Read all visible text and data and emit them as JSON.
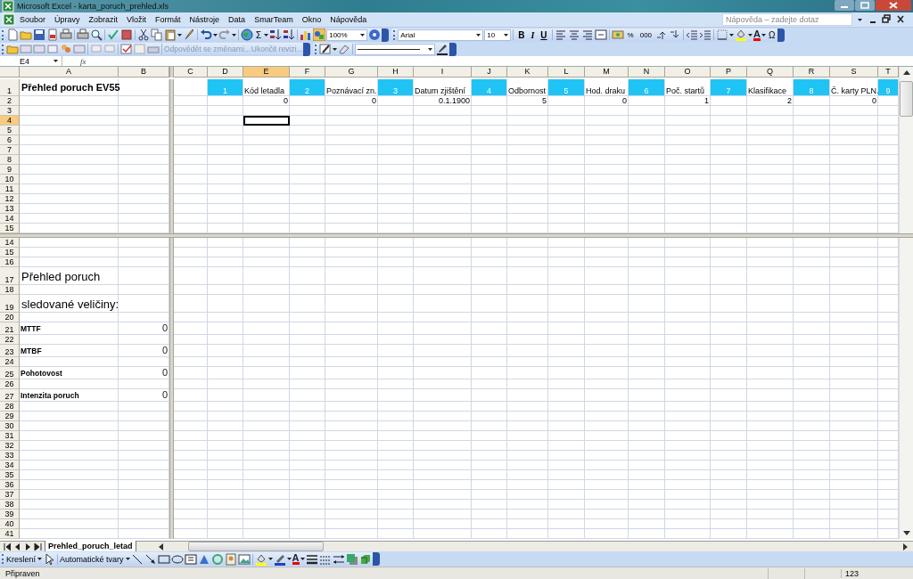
{
  "window": {
    "title": "Microsoft Excel - karta_poruch_prehled.xls"
  },
  "menu": [
    "Soubor",
    "Úpravy",
    "Zobrazit",
    "Vložit",
    "Formát",
    "Nástroje",
    "Data",
    "SmarTeam",
    "Okno",
    "Nápověda"
  ],
  "help_search": {
    "placeholder": "Nápověda – zadejte dotaz"
  },
  "standard_toolbar": {
    "sum": "Σ",
    "zoom": "100%"
  },
  "formatting_toolbar": {
    "font": "Arial",
    "size": "10",
    "style_buttons": [
      "B",
      "I",
      "U"
    ],
    "number_buttons": [
      "%",
      "000"
    ],
    "font_color": "A",
    "symbol": "Ω"
  },
  "review_toolbar": {
    "buttons": [
      {
        "label": "Odpovědět se změnami...",
        "disabled": true
      },
      {
        "label": "Ukončit revizi...",
        "disabled": true
      }
    ]
  },
  "formula_bar": {
    "name_box": "E4",
    "fx": "fx"
  },
  "columns_left": [
    {
      "label": "A",
      "selected": false
    },
    {
      "label": "B",
      "selected": false
    }
  ],
  "columns_right": [
    {
      "label": "C",
      "selected": false
    },
    {
      "label": "D",
      "selected": false
    },
    {
      "label": "E",
      "selected": true
    },
    {
      "label": "F",
      "selected": false
    },
    {
      "label": "G",
      "selected": false
    },
    {
      "label": "H",
      "selected": false
    },
    {
      "label": "I",
      "selected": false
    },
    {
      "label": "J",
      "selected": false
    },
    {
      "label": "K",
      "selected": false
    },
    {
      "label": "L",
      "selected": false
    },
    {
      "label": "M",
      "selected": false
    },
    {
      "label": "N",
      "selected": false
    },
    {
      "label": "O",
      "selected": false
    },
    {
      "label": "P",
      "selected": false
    },
    {
      "label": "Q",
      "selected": false
    },
    {
      "label": "R",
      "selected": false
    },
    {
      "label": "S",
      "selected": false
    },
    {
      "label": "T",
      "selected": false
    }
  ],
  "top_pane": {
    "rows": [
      {
        "label": "1",
        "selected": false,
        "left": [
          {
            "kind": "title",
            "text": "Přehled poruch EV55"
          }
        ],
        "right": [
          {
            "kind": "blank"
          },
          {
            "kind": "header",
            "text": "1"
          },
          {
            "kind": "label",
            "text": "Kód letadla"
          },
          {
            "kind": "header",
            "text": "2"
          },
          {
            "kind": "label",
            "text": "Poznávací zn."
          },
          {
            "kind": "header",
            "text": "3"
          },
          {
            "kind": "label",
            "text": "Datum zjištění"
          },
          {
            "kind": "header",
            "text": "4"
          },
          {
            "kind": "label",
            "text": "Odbornost"
          },
          {
            "kind": "header",
            "text": "5"
          },
          {
            "kind": "label",
            "text": "Hod. draku"
          },
          {
            "kind": "header",
            "text": "6"
          },
          {
            "kind": "label",
            "text": "Poč. startů"
          },
          {
            "kind": "header",
            "text": "7"
          },
          {
            "kind": "label",
            "text": "Klasifikace"
          },
          {
            "kind": "header",
            "text": "8"
          },
          {
            "kind": "label",
            "text": "Č. karty PLN."
          },
          {
            "kind": "header",
            "text": "9"
          }
        ]
      },
      {
        "label": "2",
        "selected": false,
        "right": [
          {
            "kind": "blank"
          },
          {
            "kind": "blank"
          },
          {
            "kind": "number",
            "text": "0"
          },
          {
            "kind": "blank"
          },
          {
            "kind": "number",
            "text": "0"
          },
          {
            "kind": "blank"
          },
          {
            "kind": "number",
            "text": "0.1.1900"
          },
          {
            "kind": "blank"
          },
          {
            "kind": "number",
            "text": "5"
          },
          {
            "kind": "blank"
          },
          {
            "kind": "number",
            "text": "0"
          },
          {
            "kind": "blank"
          },
          {
            "kind": "number",
            "text": "1"
          },
          {
            "kind": "blank"
          },
          {
            "kind": "number",
            "text": "2"
          },
          {
            "kind": "blank"
          },
          {
            "kind": "number",
            "text": "0"
          }
        ]
      },
      {
        "label": "3",
        "selected": false
      },
      {
        "label": "4",
        "selected": true,
        "right": [
          {
            "kind": "blank"
          },
          {
            "kind": "blank"
          },
          {
            "kind": "blank",
            "active": true
          }
        ]
      },
      {
        "label": "5",
        "selected": false
      },
      {
        "label": "6",
        "selected": false
      },
      {
        "label": "7",
        "selected": false
      },
      {
        "label": "8",
        "selected": false
      },
      {
        "label": "9",
        "selected": false
      },
      {
        "label": "10",
        "selected": false
      },
      {
        "label": "11",
        "selected": false
      },
      {
        "label": "12",
        "selected": false
      },
      {
        "label": "13",
        "selected": false
      },
      {
        "label": "14",
        "selected": false
      },
      {
        "label": "15",
        "selected": false
      }
    ]
  },
  "bottom_pane": {
    "rows": [
      {
        "label": "14",
        "selected": false
      },
      {
        "label": "15",
        "selected": false
      },
      {
        "label": "16",
        "selected": false
      },
      {
        "label": "17",
        "selected": false,
        "left": [
          {
            "kind": "heading",
            "text": "Přehled poruch"
          }
        ]
      },
      {
        "label": "18",
        "selected": false
      },
      {
        "label": "19",
        "selected": false,
        "left": [
          {
            "kind": "heading",
            "text": "sledované veličiny:"
          }
        ]
      },
      {
        "label": "20",
        "selected": false
      },
      {
        "label": "21",
        "selected": false,
        "left": [
          {
            "kind": "bold",
            "text": "MTTF"
          },
          {
            "kind": "value",
            "text": "0"
          }
        ]
      },
      {
        "label": "22",
        "selected": false
      },
      {
        "label": "23",
        "selected": false,
        "left": [
          {
            "kind": "bold",
            "text": "MTBF"
          },
          {
            "kind": "value",
            "text": "0"
          }
        ]
      },
      {
        "label": "24",
        "selected": false
      },
      {
        "label": "25",
        "selected": false,
        "left": [
          {
            "kind": "bold",
            "text": "Pohotovost"
          },
          {
            "kind": "value",
            "text": "0"
          }
        ]
      },
      {
        "label": "26",
        "selected": false
      },
      {
        "label": "27",
        "selected": false,
        "left": [
          {
            "kind": "bold",
            "text": "Intenzita poruch"
          },
          {
            "kind": "value",
            "text": "0"
          }
        ]
      },
      {
        "label": "28",
        "selected": false
      },
      {
        "label": "29",
        "selected": false
      },
      {
        "label": "30",
        "selected": false
      },
      {
        "label": "31",
        "selected": false
      },
      {
        "label": "32",
        "selected": false
      },
      {
        "label": "33",
        "selected": false
      },
      {
        "label": "34",
        "selected": false
      },
      {
        "label": "35",
        "selected": false
      },
      {
        "label": "36",
        "selected": false
      },
      {
        "label": "37",
        "selected": false
      },
      {
        "label": "38",
        "selected": false
      },
      {
        "label": "39",
        "selected": false
      },
      {
        "label": "40",
        "selected": false
      },
      {
        "label": "41",
        "selected": false
      }
    ]
  },
  "sheet_tabs": [
    {
      "label": "Prehled_poruch_letad",
      "selected": true
    }
  ],
  "drawing_toolbar": {
    "draw_menu": "Kreslení",
    "autoshapes_menu": "Automatické tvary",
    "font_color": "A"
  },
  "status_bar": {
    "status": "Připraven",
    "indicator": "123"
  }
}
